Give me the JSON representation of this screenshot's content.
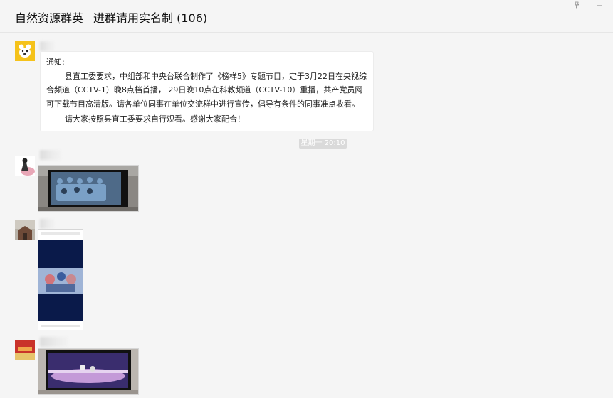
{
  "chat": {
    "title": "自然资源群英",
    "subtitle": "进群请用实名制 (106)"
  },
  "message1": {
    "line_heading": "通知:",
    "line_body": "县直工委要求，中组部和中央台联合制作了《榜样5》专题节目，定于3月22日在央视综合频道（CCTV-1）晚8点档首播， 29日晚10点在科教频道（CCTV-10）重播，共产党员网可下载节目高清版。请各单位同事在单位交流群中进行宣传，倡导有条件的同事准点收看。",
    "line_closing": "请大家按照县直工委要求自行观看。感谢大家配合！"
  },
  "timestamp": "星期一 20:10",
  "icons": {
    "pin": "pin-icon",
    "minimize": "minimize-icon"
  },
  "colors": {
    "background": "#f5f5f5",
    "bubble": "#ffffff",
    "timestamp_bg": "#dadada"
  }
}
